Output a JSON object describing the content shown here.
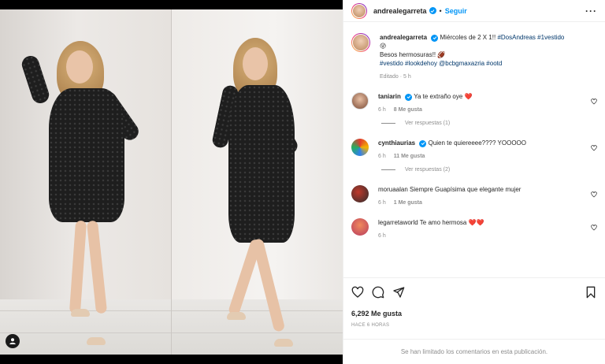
{
  "post": {
    "username": "andrealegarreta",
    "separator": "•",
    "follow_label": "Seguir",
    "more_label": "···"
  },
  "caption": {
    "username": "andrealegarreta",
    "text": "Miércoles de 2 X 1!!",
    "hashtags_1": "#DosAndreas #1vestido",
    "emoji": "😜",
    "line2": "Besos hermosuras!! 🏈",
    "hashtags_2": "#vestido #lookdehoy @bcbgmaxazria #ootd",
    "edited": "Editado",
    "time": "5 h"
  },
  "comments": [
    {
      "username": "taniarin",
      "verified": true,
      "text": "Ya te extraño oye",
      "emoji": "❤️",
      "time": "6 h",
      "likes": "8 Me gusta",
      "replies": "Ver respuestas (1)"
    },
    {
      "username": "cynthiaurias",
      "verified": true,
      "text": "Quien te quiereeee???? YOOOOO",
      "emoji": "",
      "time": "6 h",
      "likes": "11 Me gusta",
      "replies": "Ver respuestas (2)"
    },
    {
      "username": "moruaalan",
      "verified": false,
      "text": "Siempre Guapísima que elegante mujer",
      "emoji": "",
      "time": "6 h",
      "likes": "1 Me gusta",
      "replies": ""
    },
    {
      "username": "legarretaworld",
      "verified": false,
      "text": "Te amo hermosa",
      "emoji": "❤️❤️",
      "time": "6 h",
      "likes": "",
      "replies": ""
    }
  ],
  "footer": {
    "likes": "6,292 Me gusta",
    "posted_ago": "HACE 6 HORAS",
    "comments_limited": "Se han limitado los comentarios en esta publicación."
  },
  "icons": {
    "like": "heart-icon",
    "comment": "comment-icon",
    "share": "share-icon",
    "save": "bookmark-icon",
    "user_tag": "user-tag-icon"
  },
  "colors": {
    "accent": "#0095f6",
    "text": "#262626",
    "muted": "#8e8e8e",
    "link": "#00376b",
    "heart_red": "#ed4956"
  }
}
